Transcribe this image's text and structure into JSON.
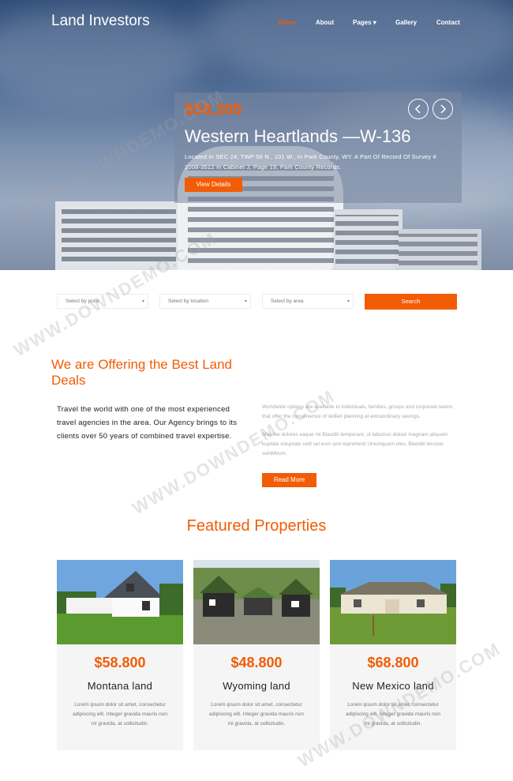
{
  "brand": "Land Investors",
  "nav": [
    {
      "label": "Home",
      "active": true
    },
    {
      "label": "About",
      "active": false
    },
    {
      "label": "Pages ▾",
      "active": false
    },
    {
      "label": "Gallery",
      "active": false
    },
    {
      "label": "Contact",
      "active": false
    }
  ],
  "hero": {
    "price": "$58,300",
    "title": "Western Heartlands —W-136",
    "description": "Located In SEC 24, TWP 58 N., 101 W., In Park County, WY. A Part Of Record Of Survey # 2008-3512 In Cabinet J, Page 19, Park County Records.",
    "button": "View Details"
  },
  "search": {
    "price_placeholder": "Select by price",
    "location_placeholder": "Select by location",
    "area_placeholder": "Select by area",
    "button": "Search"
  },
  "about": {
    "title": "We are Offering the Best Land Deals",
    "lead": "Travel the world with one of the most experienced travel agencies in the area. Our Agency brings to its clients over 50 years of combined travel expertise.",
    "para1": "Worldwide options are available to individuals, families, groups and corporate teams that offer the convenience of skilled planning at extraordinary savings.",
    "para2": "Maxime dolores eaque mi Blanditi temporant, ut laboriosi dolore magnam aliquam kuptate voluptate velit sel eum iure reprehend Unicmquam eles, Blanditi tenuser sehiMirum.",
    "button": "Read More"
  },
  "featured": {
    "title": "Featured Properties",
    "cards": [
      {
        "price": "$58.800",
        "name": "Montana land",
        "desc": "Lorem ipsum dolor sit amet, consectetur adipiscing elit. Integer gravida mauris non mi gravida, at sollicitudin."
      },
      {
        "price": "$48.800",
        "name": "Wyoming land",
        "desc": "Lorem ipsum dolor sit amet, consectetur adipiscing elit. Integer gravida mauris non mi gravida, at sollicitudin."
      },
      {
        "price": "$68.800",
        "name": "New Mexico land",
        "desc": "Lorem ipsum dolor sit amet, consectetur adipiscing elit. Integer gravida mauris non mi gravida, at sollicitudin."
      }
    ]
  },
  "watermark": "WWW.DOWNDEMO.COM"
}
